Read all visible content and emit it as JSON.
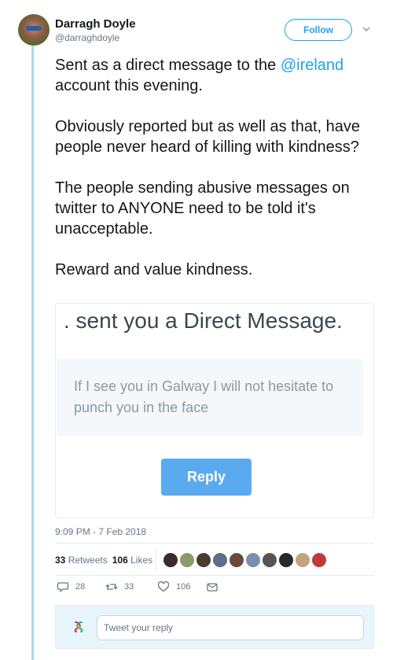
{
  "author": {
    "name": "Darragh Doyle",
    "handle": "@darraghdoyle"
  },
  "header": {
    "follow_label": "Follow"
  },
  "tweet": {
    "line1": "Sent as a direct message to the ",
    "mention": "@ireland",
    "line1_rest": " account this evening.",
    "paragraph2": "Obviously reported but as well as that, have people never heard of killing with kindness?",
    "paragraph3": "The people sending abusive messages on twitter to ANYONE need to be told it's unacceptable.",
    "paragraph4": "Reward and value kindness."
  },
  "card": {
    "header": ". sent you a Direct Message.",
    "message": "If I see you in Galway I will not hesitate to punch you in the face",
    "reply_label": "Reply"
  },
  "timestamp": "9:09 PM - 7 Feb 2018",
  "stats": {
    "retweets_count": "33",
    "retweets_label": "Retweets",
    "likes_count": "106",
    "likes_label": "Likes"
  },
  "likers": [
    {
      "color": "#3b2b2e"
    },
    {
      "color": "#8a9a6a"
    },
    {
      "color": "#4a3a30"
    },
    {
      "color": "#5b6f8a"
    },
    {
      "color": "#6b4a3a"
    },
    {
      "color": "#7a8fb0"
    },
    {
      "color": "#555555"
    },
    {
      "color": "#2a2a2a"
    },
    {
      "color": "#c2a37a"
    },
    {
      "color": "#c0393f"
    }
  ],
  "actions": {
    "replies": "28",
    "retweets": "33",
    "likes": "106"
  },
  "reply_box": {
    "placeholder": "Tweet your reply"
  },
  "icons": [
    "avatar",
    "chevron-down-icon",
    "reply-icon",
    "retweet-icon",
    "heart-icon",
    "mail-icon",
    "user-avatar-icon"
  ],
  "colors": {
    "accent": "#1da1f2",
    "reply_button": "#5aaaf0",
    "thread_line": "#a5dcf0"
  }
}
